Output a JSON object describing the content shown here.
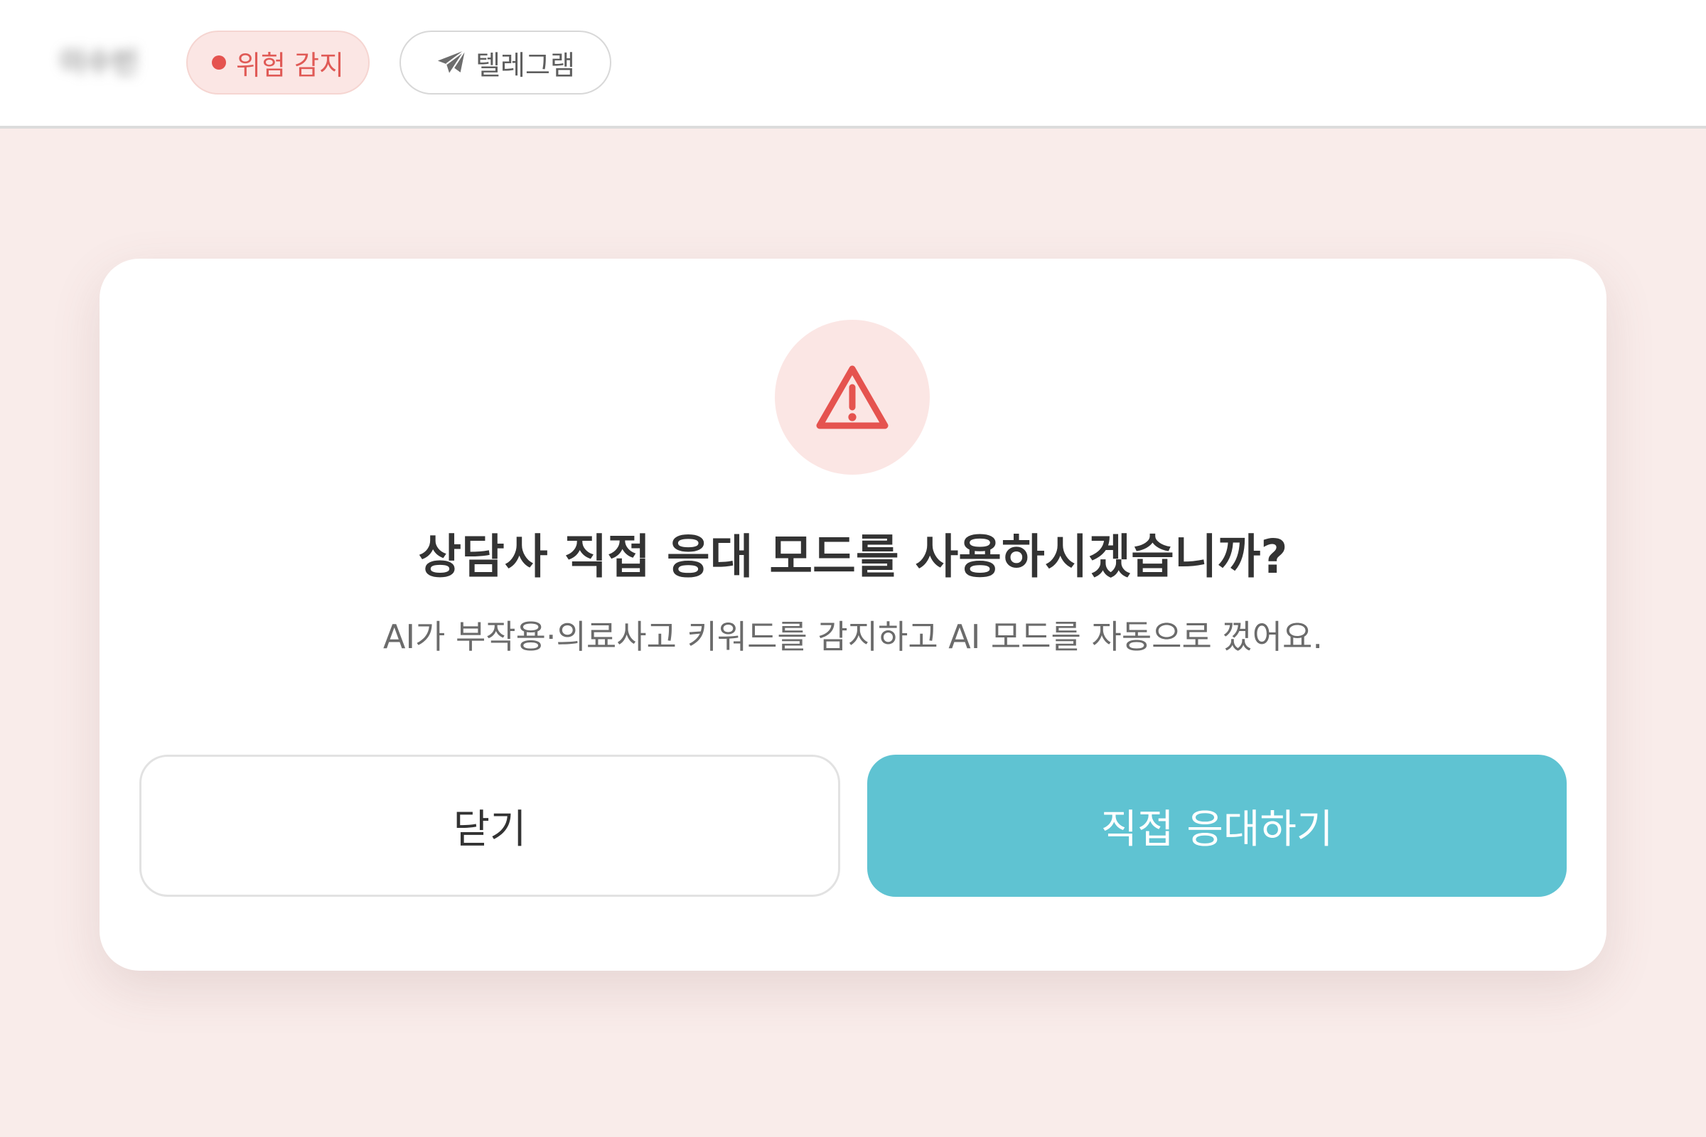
{
  "header": {
    "user_name": "이수빈",
    "risk_badge_label": "위험 감지",
    "telegram_label": "텔레그램"
  },
  "modal": {
    "icon": "warning-triangle-icon",
    "title": "상담사 직접 응대 모드를 사용하시겠습니까?",
    "description": "AI가 부작용·의료사고 키워드를 감지하고 AI 모드를 자동으로 껐어요.",
    "close_label": "닫기",
    "confirm_label": "직접 응대하기"
  },
  "colors": {
    "background": "#f9ecea",
    "danger": "#e5534f",
    "accent": "#5fc3d2"
  }
}
